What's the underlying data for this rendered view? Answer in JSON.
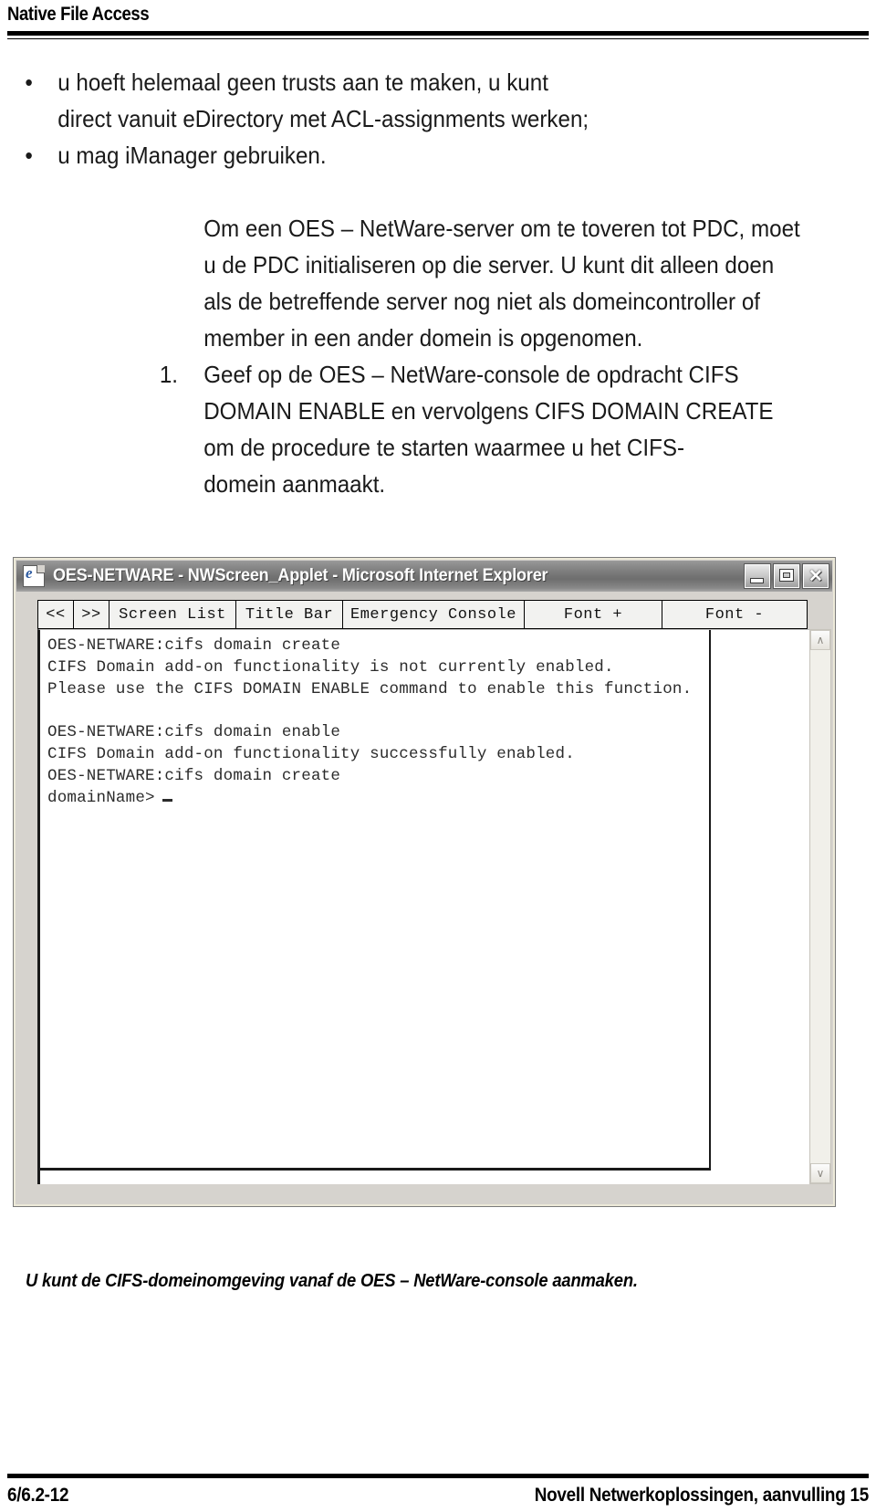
{
  "header": {
    "running_head": "Native File Access"
  },
  "body": {
    "bullets": [
      {
        "marker": "•",
        "lines": [
          {
            "text": "u hoeft helemaal geen trusts aan te maken, u kunt",
            "justify": true
          },
          {
            "text": "direct vanuit eDirectory met ACL-assignments werken;",
            "justify": false
          }
        ]
      },
      {
        "marker": "•",
        "lines": [
          {
            "text": "u mag iManager gebruiken.",
            "justify": false
          }
        ]
      }
    ],
    "paragraph": {
      "lines": [
        {
          "text": "Om een OES – NetWare-server om te toveren tot PDC, moet",
          "justify": false
        },
        {
          "text": "u de PDC initialiseren op die server. U kunt dit alleen doen",
          "justify": false
        },
        {
          "text": "als de betreffende server nog niet als domeincontroller of",
          "justify": true
        },
        {
          "text": "member in een ander domein is opgenomen.",
          "justify": false
        }
      ]
    },
    "numbered_item": {
      "marker": "1.",
      "lines": [
        {
          "text": "Geef op de OES – NetWare-console de opdracht CIFS",
          "justify": true
        },
        {
          "text": "DOMAIN ENABLE en vervolgens CIFS DOMAIN CREATE",
          "justify": true
        },
        {
          "text": "om de procedure te starten waarmee u het CIFS-",
          "justify": true
        },
        {
          "text": "domein aanmaakt.",
          "justify": false
        }
      ]
    }
  },
  "ie_window": {
    "title": "OES-NETWARE - NWScreen_Applet - Microsoft Internet Explorer",
    "app_icon": "internet-explorer-document-icon",
    "window_buttons": [
      {
        "name": "minimize",
        "label": "_"
      },
      {
        "name": "restore",
        "label": "❐"
      },
      {
        "name": "close",
        "label": "✕"
      }
    ],
    "toolbar": [
      {
        "name": "prev",
        "label": "<<"
      },
      {
        "name": "next",
        "label": ">>"
      },
      {
        "name": "screen-list",
        "label": "Screen List"
      },
      {
        "name": "title-bar",
        "label": "Title Bar"
      },
      {
        "name": "emergency-console",
        "label": "Emergency Console"
      },
      {
        "name": "font-plus",
        "label": "Font +"
      },
      {
        "name": "font-minus",
        "label": "Font -"
      }
    ],
    "console_lines": [
      "OES-NETWARE:cifs domain create",
      "CIFS Domain add-on functionality is not currently enabled.",
      "Please use the CIFS DOMAIN ENABLE command to enable this function.",
      "",
      "OES-NETWARE:cifs domain enable",
      "CIFS Domain add-on functionality successfully enabled.",
      "OES-NETWARE:cifs domain create",
      "domainName>"
    ],
    "scrollbar": {
      "up_arrow": "∧",
      "down_arrow": "∨"
    }
  },
  "caption": "U kunt de CIFS-domeinomgeving vanaf de OES – NetWare-console aanmaken.",
  "footer": {
    "left": "6/6.2-12",
    "right": "Novell Netwerkoplossingen, aanvulling 15"
  }
}
